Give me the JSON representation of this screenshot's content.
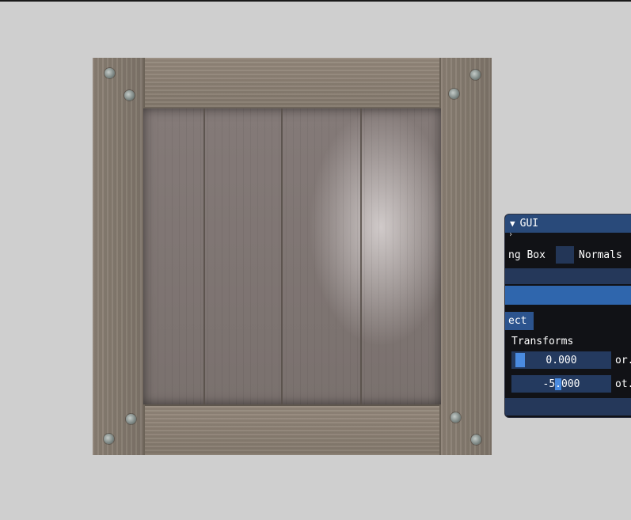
{
  "gui": {
    "title": "GUI",
    "collapse_glyph": "▼",
    "small_glyph": "›",
    "checkbox_row": {
      "left_label": "ng Box",
      "right_label": "Normals"
    },
    "button_label": "ect",
    "section_label": "Transforms",
    "fields": [
      {
        "value": "0.000",
        "side_label": "or."
      },
      {
        "value_before_cursor": "-5",
        "value_cursor": ".",
        "value_after_cursor": "000",
        "side_label": "ot."
      }
    ]
  },
  "colors": {
    "background": "#cfcfcf",
    "gui_title": "#294a7a",
    "gui_bg": "#111216",
    "field_bg": "#243a5f",
    "accent": "#4a8be0"
  }
}
